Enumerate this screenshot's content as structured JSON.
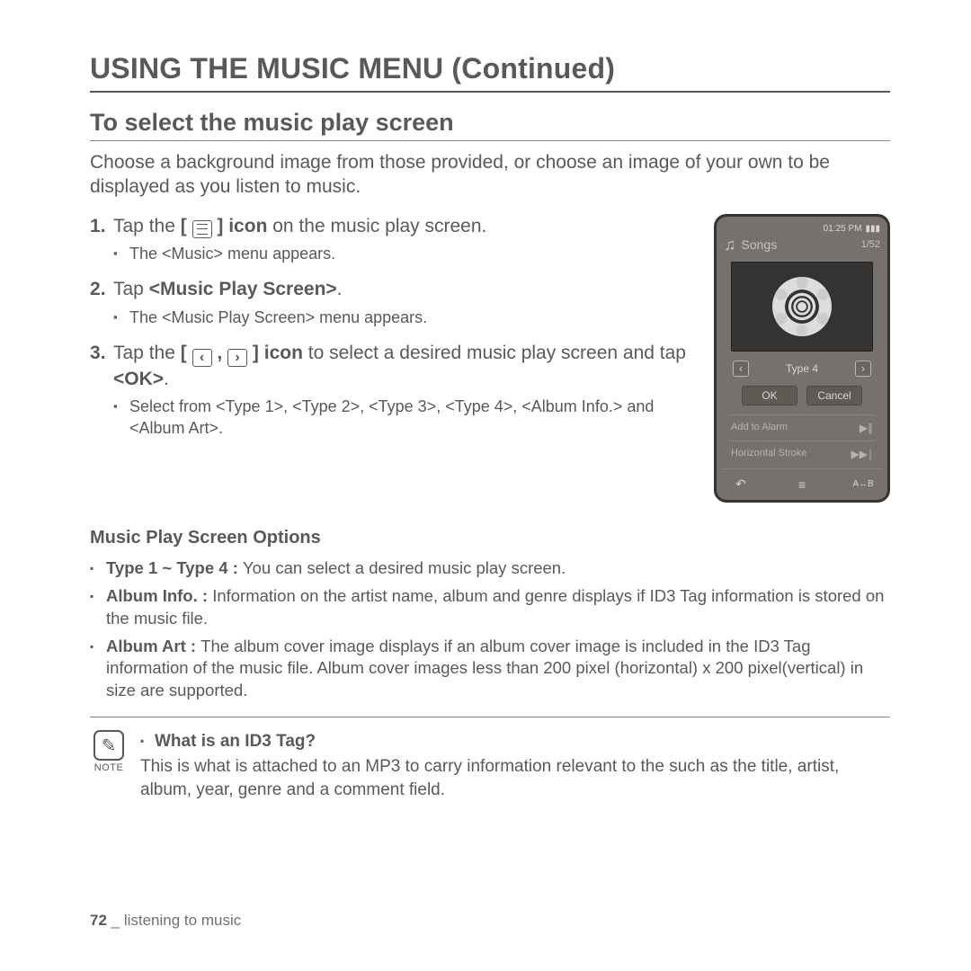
{
  "title": "USING THE MUSIC MENU (Continued)",
  "section_title": "To select the music play screen",
  "intro": "Choose a background image from those provided, or choose an image of your own to be displayed as you listen to music.",
  "steps": {
    "s1_a": "Tap the ",
    "s1_b": " icon",
    "s1_c": " on the music play screen.",
    "s1_sub": "The <Music> menu appears.",
    "s2_a": "Tap ",
    "s2_b": "<Music Play Screen>",
    "s2_c": ".",
    "s2_sub": "The <Music Play Screen> menu appears.",
    "s3_a": "Tap the ",
    "s3_b": " icon",
    "s3_c": " to select a desired music play screen and tap ",
    "s3_d": "<OK>",
    "s3_e": ".",
    "s3_sub": "Select from <Type 1>, <Type 2>, <Type 3>, <Type 4>, <Album Info.> and <Album Art>."
  },
  "device": {
    "time": "01:25 PM",
    "header": "Songs",
    "counter": "1/52",
    "type_label": "Type 4",
    "ok": "OK",
    "cancel": "Cancel",
    "row1": "Add to Alarm",
    "row2": "Horizontal Stroke",
    "ab": "A↔B"
  },
  "options_title": "Music Play Screen Options",
  "options": {
    "o1_lead": "Type 1 ~ Type 4 : ",
    "o1_body": "You can select a desired music play screen.",
    "o2_lead": "Album Info. : ",
    "o2_body": "Information on the artist name, album and genre displays if ID3 Tag information is stored on the music file.",
    "o3_lead": "Album Art : ",
    "o3_body": "The album cover image displays if an album cover image is included in the ID3 Tag information of the music file. Album cover images less than 200 pixel (horizontal) x 200 pixel(vertical) in size are supported."
  },
  "note": {
    "label": "NOTE",
    "q": "What is an ID3 Tag?",
    "body": "This is what is attached to an MP3 to carry information relevant to the such as the title, artist, album, year, genre and a comment field."
  },
  "footer": {
    "page": "72",
    "sep": " _ ",
    "chapter": "listening to music"
  }
}
